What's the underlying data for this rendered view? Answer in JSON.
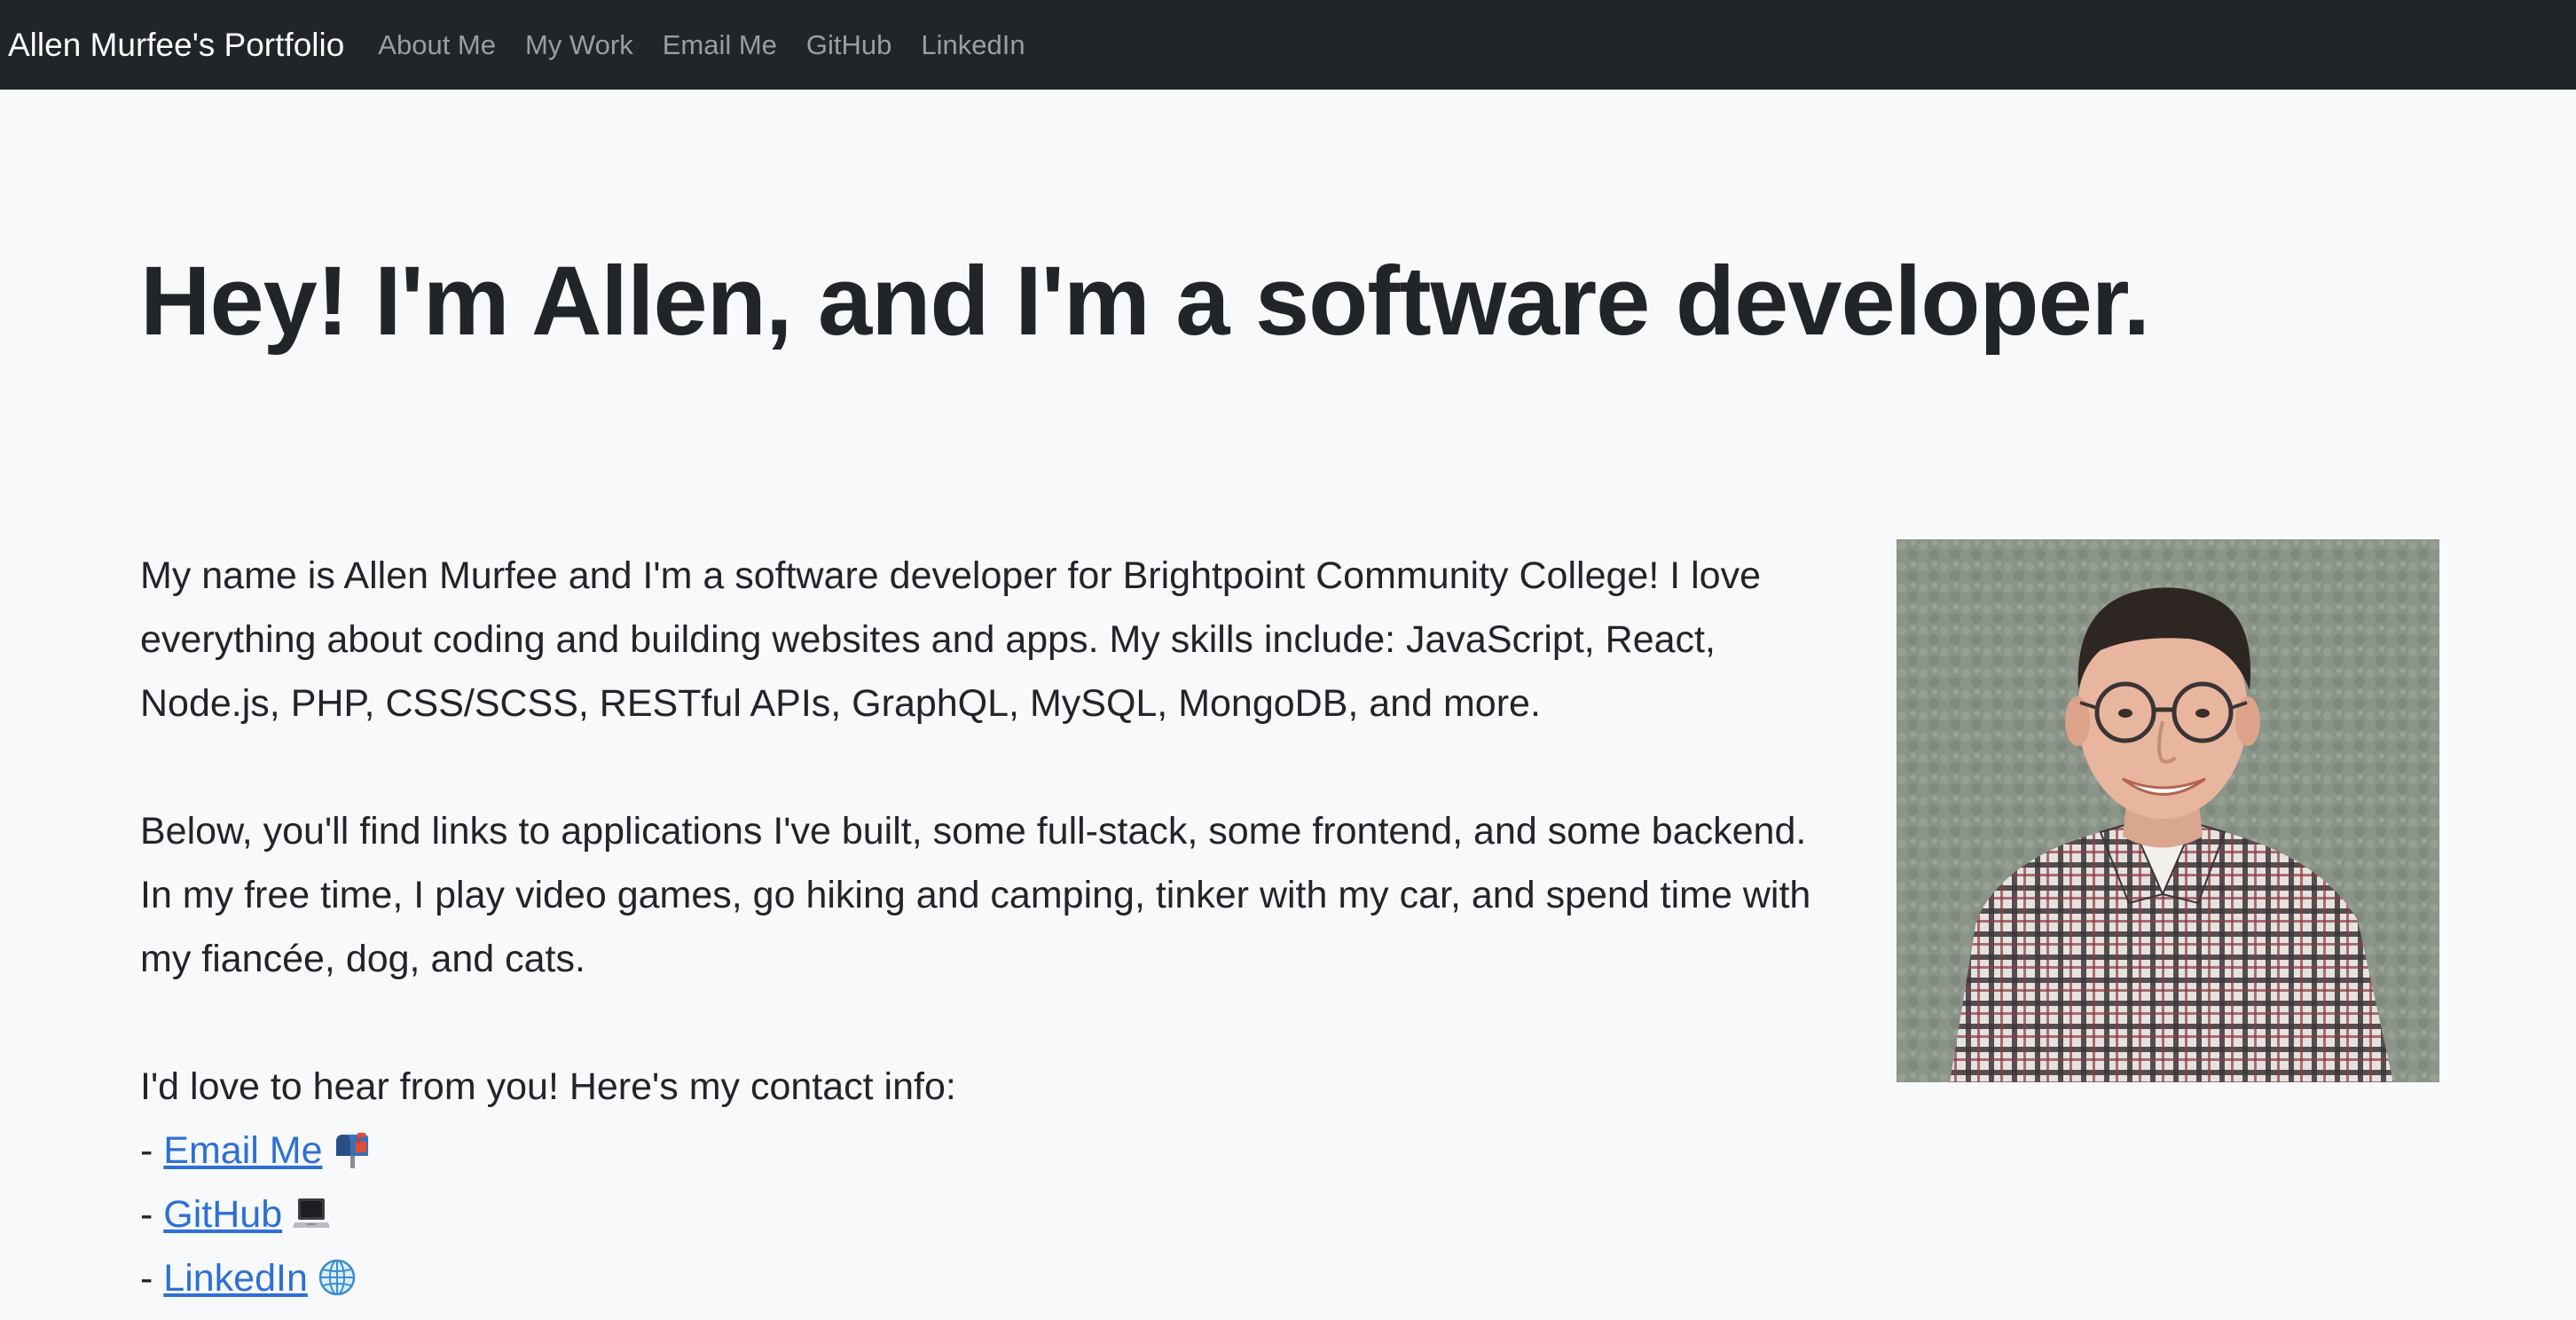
{
  "navbar": {
    "brand": "Allen Murfee's Portfolio",
    "links": [
      "About Me",
      "My Work",
      "Email Me",
      "GitHub",
      "LinkedIn"
    ]
  },
  "hero": {
    "heading": "Hey! I'm Allen, and I'm a software developer.",
    "paragraph1": "My name is Allen Murfee and I'm a software developer for Brightpoint Community College! I love everything about coding and building websites and apps. My skills include: JavaScript, React, Node.js, PHP, CSS/SCSS, RESTful APIs, GraphQL, MySQL, MongoDB, and more.",
    "paragraph2": "Below, you'll find links to applications I've built, some full-stack, some frontend, and some backend. In my free time, I play video games, go hiking and camping, tinker with my car, and spend time with my fiancée, dog, and cats.",
    "contact_intro": "I'd love to hear from you! Here's my contact info:",
    "contact_prefix": "- ",
    "contacts": [
      {
        "label": "Email Me",
        "icon": "mailbox-icon"
      },
      {
        "label": "GitHub",
        "icon": "laptop-icon"
      },
      {
        "label": "LinkedIn",
        "icon": "globe-icon"
      }
    ]
  },
  "colors": {
    "navbar_bg": "#212529",
    "page_bg": "#f8f9fa",
    "link": "#2d6fd6",
    "nav_link": "#9a9da1"
  }
}
